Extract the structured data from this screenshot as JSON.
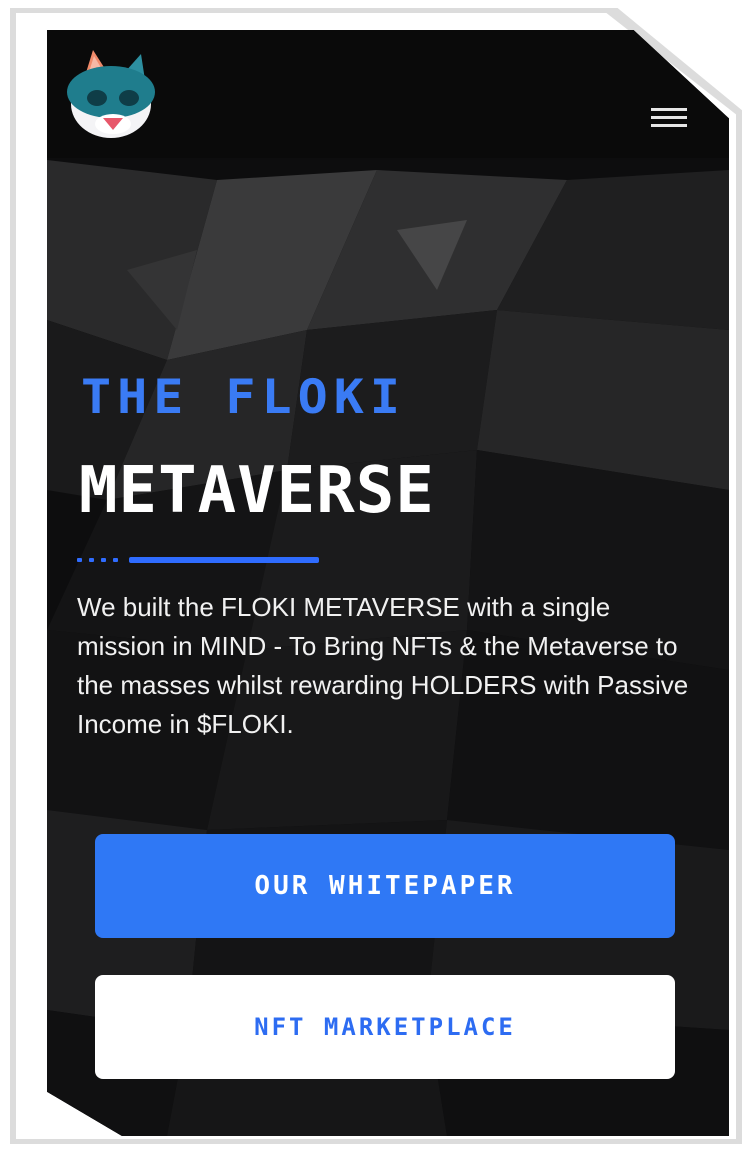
{
  "header": {
    "logo_icon": "floki-cat-logo-icon",
    "menu_icon": "hamburger-menu-icon"
  },
  "hero": {
    "title_line1": "THE FLOKI",
    "title_line2": "METAVERSE",
    "description": "We built the FLOKI METAVERSE with a single mission in MIND - To Bring NFTs & the Metaverse to the masses whilst rewarding HOLDERS with Passive Income in $FLOKI."
  },
  "buttons": {
    "whitepaper_label": "OUR WHITEPAPER",
    "marketplace_label": "NFT MARKETPLACE"
  },
  "colors": {
    "accent": "#2f78f5",
    "title_blue": "#3a7bf4",
    "background": "#0b0b0c"
  }
}
